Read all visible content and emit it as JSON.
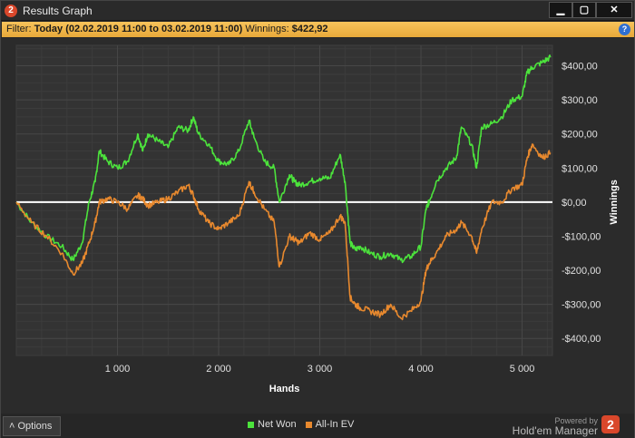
{
  "window": {
    "title": "Results Graph",
    "app_icon_glyph": "2",
    "minimize_glyph": "▁",
    "maximize_glyph": "▢",
    "close_glyph": "✕"
  },
  "filter": {
    "prefix": "Filter: ",
    "range": "Today (02.02.2019 11:00 to 03.02.2019 11:00)",
    "winnings_label": "Winnings: ",
    "winnings_value": "$422,92",
    "help_glyph": "?"
  },
  "chart_data": {
    "type": "line",
    "xlabel": "Hands",
    "ylabel": "Winnings",
    "xlim": [
      0,
      5300
    ],
    "ylim": [
      -450,
      460
    ],
    "x_ticks": [
      1000,
      2000,
      3000,
      4000,
      5000
    ],
    "x_tick_labels": [
      "1 000",
      "2 000",
      "3 000",
      "4 000",
      "5 000"
    ],
    "y_ticks": [
      400,
      300,
      200,
      100,
      0,
      -100,
      -200,
      -300,
      -400
    ],
    "y_tick_labels": [
      "$400,00",
      "$300,00",
      "$200,00",
      "$100,00",
      "$0,00",
      "-$100,00",
      "-$200,00",
      "-$300,00",
      "-$400,00"
    ],
    "grid": true,
    "legend_position": "bottom-center",
    "series": [
      {
        "name": "Net Won",
        "color": "#4ce33c",
        "x": [
          0,
          150,
          300,
          450,
          560,
          650,
          720,
          780,
          820,
          900,
          1000,
          1100,
          1200,
          1250,
          1300,
          1400,
          1500,
          1600,
          1700,
          1750,
          1800,
          1900,
          2000,
          2100,
          2200,
          2300,
          2350,
          2450,
          2550,
          2600,
          2700,
          2750,
          2800,
          2900,
          3000,
          3100,
          3200,
          3250,
          3300,
          3350,
          3400,
          3500,
          3600,
          3700,
          3800,
          3900,
          4000,
          4050,
          4080,
          4150,
          4250,
          4350,
          4400,
          4500,
          4550,
          4600,
          4700,
          4800,
          4900,
          5000,
          5050,
          5100,
          5200,
          5280
        ],
        "y": [
          0,
          -60,
          -100,
          -130,
          -170,
          -120,
          0,
          60,
          150,
          120,
          100,
          120,
          200,
          150,
          200,
          180,
          160,
          220,
          210,
          250,
          200,
          170,
          120,
          110,
          150,
          240,
          190,
          120,
          100,
          0,
          80,
          60,
          50,
          60,
          70,
          70,
          140,
          60,
          -120,
          -140,
          -130,
          -150,
          -160,
          -150,
          -170,
          -160,
          -130,
          -20,
          0,
          60,
          100,
          130,
          220,
          170,
          100,
          220,
          230,
          250,
          300,
          310,
          380,
          395,
          410,
          425
        ]
      },
      {
        "name": "All-In EV",
        "color": "#e8892e",
        "x": [
          0,
          150,
          300,
          450,
          560,
          650,
          720,
          780,
          820,
          900,
          1000,
          1100,
          1200,
          1250,
          1300,
          1400,
          1500,
          1600,
          1700,
          1750,
          1800,
          1900,
          2000,
          2100,
          2200,
          2300,
          2350,
          2450,
          2550,
          2600,
          2700,
          2750,
          2800,
          2900,
          3000,
          3100,
          3200,
          3250,
          3300,
          3350,
          3400,
          3500,
          3600,
          3700,
          3800,
          3900,
          4000,
          4050,
          4080,
          4150,
          4250,
          4350,
          4400,
          4500,
          4550,
          4600,
          4700,
          4800,
          4900,
          5000,
          5050,
          5100,
          5200,
          5280
        ],
        "y": [
          0,
          -60,
          -100,
          -150,
          -210,
          -180,
          -120,
          -60,
          0,
          10,
          0,
          -20,
          20,
          10,
          -10,
          0,
          10,
          30,
          50,
          20,
          -20,
          -60,
          -80,
          -60,
          -40,
          60,
          30,
          -20,
          -60,
          -190,
          -100,
          -110,
          -120,
          -90,
          -110,
          -90,
          -40,
          -60,
          -280,
          -300,
          -310,
          -320,
          -330,
          -300,
          -340,
          -320,
          -290,
          -200,
          -180,
          -150,
          -100,
          -80,
          -60,
          -100,
          -150,
          -80,
          0,
          0,
          40,
          50,
          130,
          170,
          130,
          145
        ]
      }
    ]
  },
  "bottom": {
    "options_label": "Options",
    "options_glyph": "˄",
    "legend_net_won": "Net Won",
    "legend_allin_ev": "All-In EV",
    "powered_by": "Powered by",
    "brand": "Hold'em Manager",
    "brand_logo_glyph": "2"
  }
}
